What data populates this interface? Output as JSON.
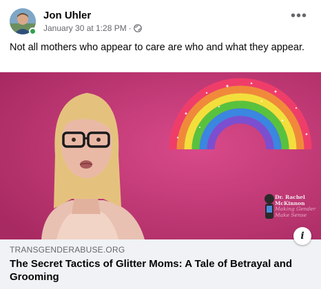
{
  "post": {
    "author": "Jon Uhler",
    "timestamp": "January 30 at 1:28 PM",
    "separator": "·",
    "privacy_icon": "globe-icon",
    "more_label": "•••",
    "text": "Not all mothers who appear to care are who and what they appear."
  },
  "media": {
    "watermark_line1": "Dr. Rachel",
    "watermark_line2": "McKinnon",
    "watermark_line3": "Making Gender",
    "watermark_line4": "Make Sense",
    "background_color": "#c23673"
  },
  "link_preview": {
    "domain": "TRANSGENDERABUSE.ORG",
    "title": "The Secret Tactics of Glitter Moms: A Tale of Betrayal and Grooming",
    "info_label": "i"
  },
  "colors": {
    "online": "#31a24c",
    "link_bg": "#f0f2f5",
    "meta_text": "#65676b"
  }
}
